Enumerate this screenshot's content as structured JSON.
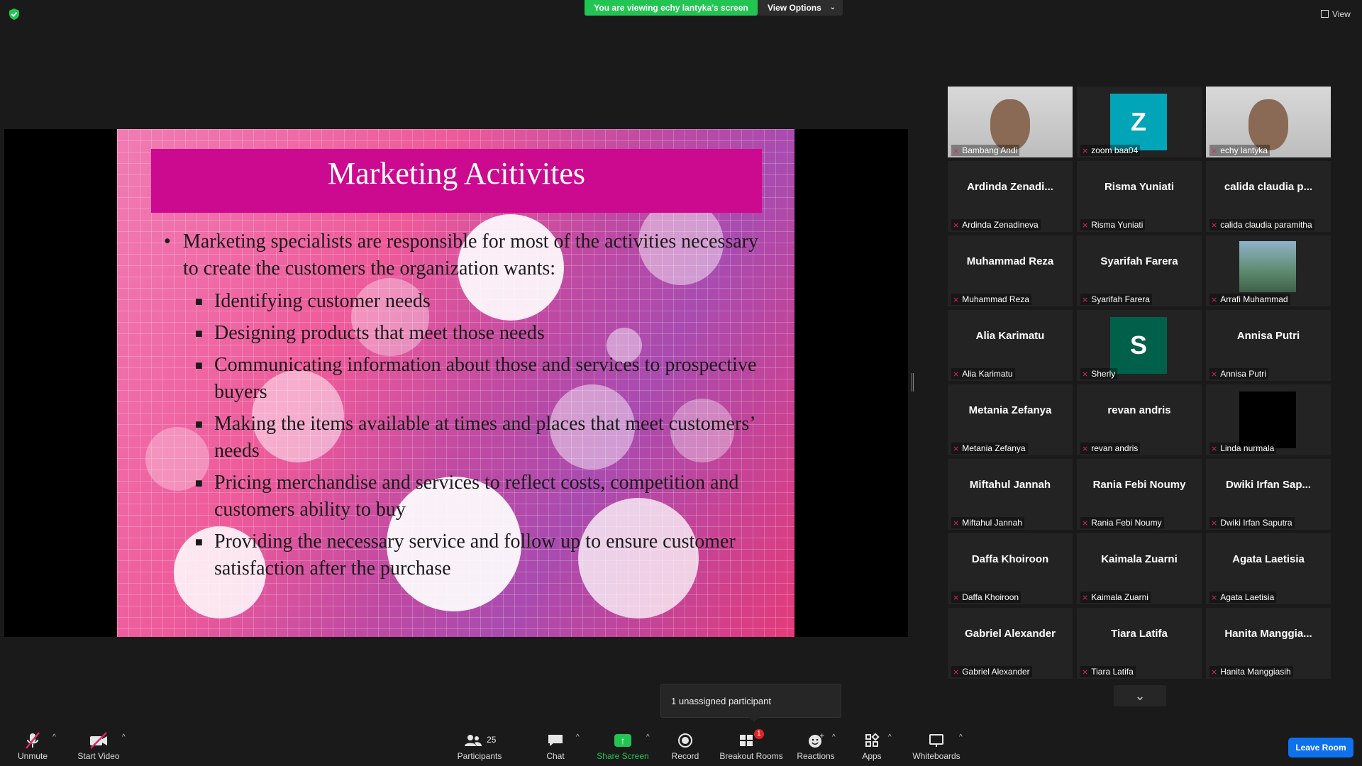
{
  "topbar": {
    "viewing_banner": "You are viewing echy lantyka's screen",
    "view_options": "View Options",
    "view": "View"
  },
  "slide": {
    "title": "Marketing Acitivites",
    "bullet_main": "Marketing specialists are responsible for most of the activities necessary to create the customers the organization wants:",
    "sub_bullets": [
      "Identifying customer needs",
      "Designing products that meet those needs",
      "Communicating information about those and services to prospective buyers",
      "Making the items available at times and places that meet customers’ needs",
      "Pricing merchandise and services to reflect costs, competition and customers ability to buy",
      "Providing the necessary service and follow up to ensure customer satisfaction after the purchase"
    ]
  },
  "gallery": {
    "tiles": [
      {
        "display": "",
        "name": "Bambang Andi",
        "kind": "video"
      },
      {
        "display": "Z",
        "name": "zoom baa04",
        "kind": "letter",
        "color": "#00a5b8"
      },
      {
        "display": "",
        "name": "echy lantyka",
        "kind": "video",
        "active": true
      },
      {
        "display": "Ardinda  Zenadi...",
        "name": "Ardinda Zenadineva",
        "kind": "text"
      },
      {
        "display": "Risma Yuniati",
        "name": "Risma Yuniati",
        "kind": "text"
      },
      {
        "display": "calida  claudia  p...",
        "name": "calida claudia paramitha",
        "kind": "text"
      },
      {
        "display": "Muhammad Reza",
        "name": "Muhammad Reza",
        "kind": "text"
      },
      {
        "display": "Syarifah Farera",
        "name": "Syarifah Farera",
        "kind": "text"
      },
      {
        "display": "",
        "name": "Arrafi Muhammad",
        "kind": "photo"
      },
      {
        "display": "Alia Karimatu",
        "name": "Alia Karimatu",
        "kind": "text"
      },
      {
        "display": "S",
        "name": "Sherly",
        "kind": "letter",
        "color": "#00604a"
      },
      {
        "display": "Annisa Putri",
        "name": "Annisa Putri",
        "kind": "text"
      },
      {
        "display": "Metania Zefanya",
        "name": "Metania Zefanya",
        "kind": "text"
      },
      {
        "display": "revan andris",
        "name": "revan andris",
        "kind": "text"
      },
      {
        "display": "",
        "name": "Linda nurmala",
        "kind": "black"
      },
      {
        "display": "Miftahul Jannah",
        "name": "Miftahul Jannah",
        "kind": "text"
      },
      {
        "display": "Rania Febi Noumy",
        "name": "Rania Febi Noumy",
        "kind": "text"
      },
      {
        "display": "Dwiki  Irfan  Sap...",
        "name": "Dwiki Irfan Saputra",
        "kind": "text"
      },
      {
        "display": "Daffa Khoiroon",
        "name": "Daffa Khoiroon",
        "kind": "text"
      },
      {
        "display": "Kaimala Zuarni",
        "name": "Kaimala Zuarni",
        "kind": "text"
      },
      {
        "display": "Agata Laetisia",
        "name": "Agata Laetisia",
        "kind": "text"
      },
      {
        "display": "Gabriel Alexander",
        "name": "Gabriel Alexander",
        "kind": "text"
      },
      {
        "display": "Tiara Latifa",
        "name": "Tiara Latifa",
        "kind": "text"
      },
      {
        "display": "Hanita  Manggia...",
        "name": "Hanita Manggiasih",
        "kind": "text"
      }
    ]
  },
  "popup": {
    "unassigned": "1 unassigned participant"
  },
  "toolbar": {
    "unmute": "Unmute",
    "start_video": "Start Video",
    "participants": "Participants",
    "participants_count": "25",
    "chat": "Chat",
    "share_screen": "Share Screen",
    "record": "Record",
    "breakout_rooms": "Breakout Rooms",
    "breakout_badge": "1",
    "reactions": "Reactions",
    "apps": "Apps",
    "whiteboards": "Whiteboards",
    "leave_room": "Leave Room"
  },
  "colors": {
    "banner_green": "#23c552",
    "slide_title_bg": "#cc0a8f",
    "leave_blue": "#0e72ed",
    "active_speaker": "#d9e94a",
    "muted_red": "#e0245e"
  }
}
